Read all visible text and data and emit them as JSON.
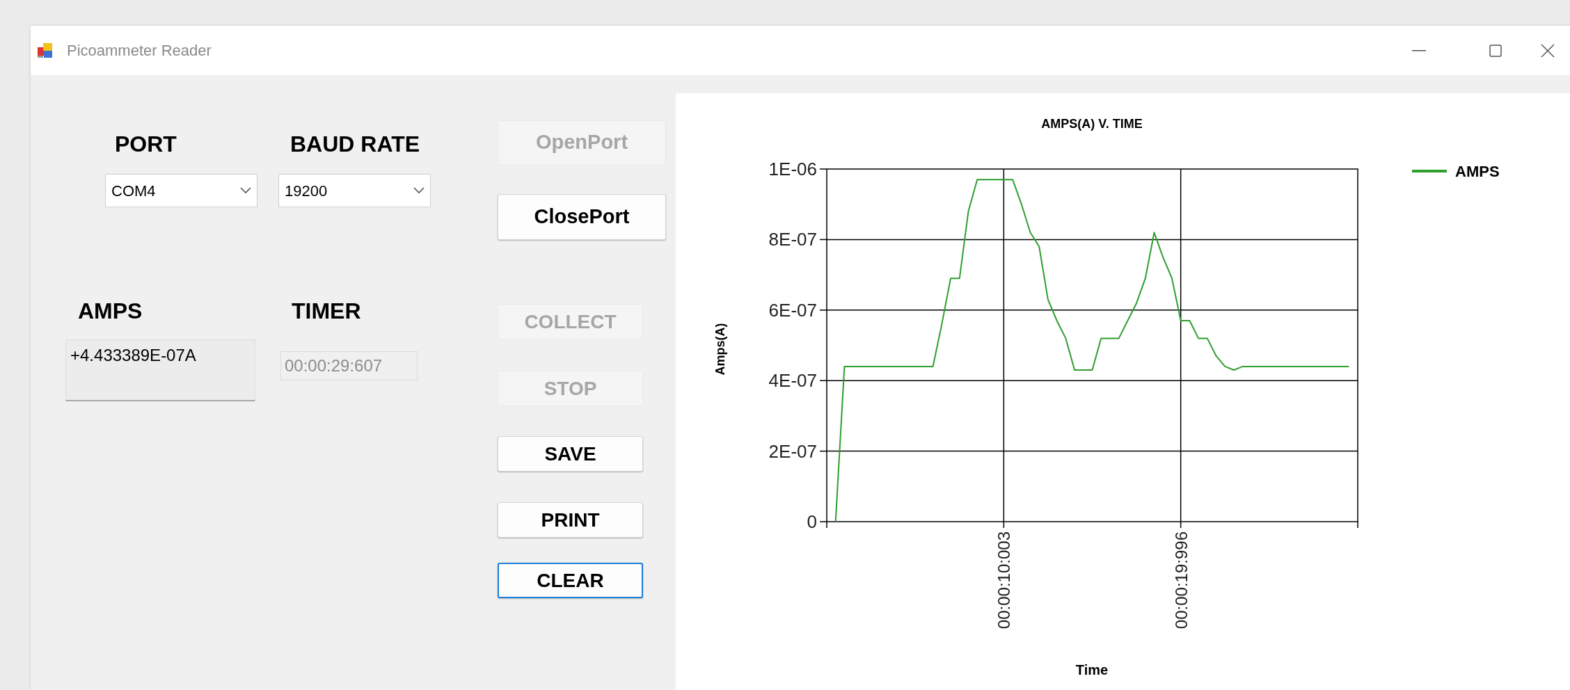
{
  "window": {
    "title": "Picoammeter Reader"
  },
  "port": {
    "label": "PORT",
    "value": "COM4"
  },
  "baud_rate": {
    "label": "BAUD RATE",
    "value": "19200"
  },
  "port_buttons": [
    {
      "label": "OpenPort",
      "disabled": true,
      "focused": false
    },
    {
      "label": "ClosePort",
      "disabled": false,
      "focused": false
    }
  ],
  "amps": {
    "label": "AMPS",
    "value": "+4.433389E-07A"
  },
  "timer": {
    "label": "TIMER",
    "value": "00:00:29:607",
    "disabled": true
  },
  "action_buttons": [
    {
      "label": "COLLECT",
      "disabled": true,
      "focused": false
    },
    {
      "label": "STOP",
      "disabled": true,
      "focused": false
    },
    {
      "label": "SAVE",
      "disabled": false,
      "focused": false
    },
    {
      "label": "PRINT",
      "disabled": false,
      "focused": false
    },
    {
      "label": "CLEAR",
      "disabled": false,
      "focused": true
    }
  ],
  "chart": {
    "chart_data": {
      "type": "line",
      "title": "AMPS(A) V. TIME",
      "xlabel": "Time",
      "ylabel": "Amps(A)",
      "categories": [
        null,
        null,
        null,
        null,
        null,
        null,
        null,
        null,
        null,
        null,
        null,
        null,
        null,
        null,
        null,
        null,
        null,
        null,
        null,
        "00:00:10:003",
        null,
        null,
        null,
        null,
        null,
        null,
        null,
        null,
        null,
        null,
        null,
        null,
        null,
        null,
        null,
        null,
        null,
        null,
        null,
        "00:00:19:996",
        null,
        null,
        null,
        null,
        null,
        null,
        null,
        null,
        null,
        null,
        null,
        null,
        null,
        null,
        null,
        null,
        null,
        null,
        null
      ],
      "series": [
        {
          "name": "AMPS",
          "color": "#2e9e2e",
          "values": [
            0,
            4.4e-07,
            4.4e-07,
            4.4e-07,
            4.4e-07,
            4.4e-07,
            4.4e-07,
            4.4e-07,
            4.4e-07,
            4.4e-07,
            4.4e-07,
            4.4e-07,
            5.6e-07,
            6.9e-07,
            6.9e-07,
            8.8e-07,
            9.7e-07,
            9.7e-07,
            9.7e-07,
            9.7e-07,
            9.7e-07,
            9e-07,
            8.2e-07,
            7.8e-07,
            6.3e-07,
            5.7e-07,
            5.2e-07,
            4.3e-07,
            4.3e-07,
            4.3e-07,
            5.2e-07,
            5.2e-07,
            5.2e-07,
            5.7e-07,
            6.2e-07,
            6.9e-07,
            8.2e-07,
            7.5e-07,
            6.9e-07,
            5.7e-07,
            5.7e-07,
            5.2e-07,
            5.2e-07,
            4.7e-07,
            4.4e-07,
            4.3e-07,
            4.4e-07,
            4.4e-07,
            4.4e-07,
            4.4e-07,
            4.4e-07,
            4.4e-07,
            4.4e-07,
            4.4e-07,
            4.4e-07,
            4.4e-07,
            4.4e-07,
            4.4e-07,
            4.4e-07
          ]
        }
      ],
      "ylim": [
        0,
        1e-06
      ],
      "grid": true,
      "yticks": [
        {
          "value": 0,
          "label": "0"
        },
        {
          "value": 2e-07,
          "label": "2E-07"
        },
        {
          "value": 4e-07,
          "label": "4E-07"
        },
        {
          "value": 6e-07,
          "label": "6E-07"
        },
        {
          "value": 8e-07,
          "label": "8E-07"
        },
        {
          "value": 1e-06,
          "label": "1E-06"
        }
      ]
    }
  }
}
